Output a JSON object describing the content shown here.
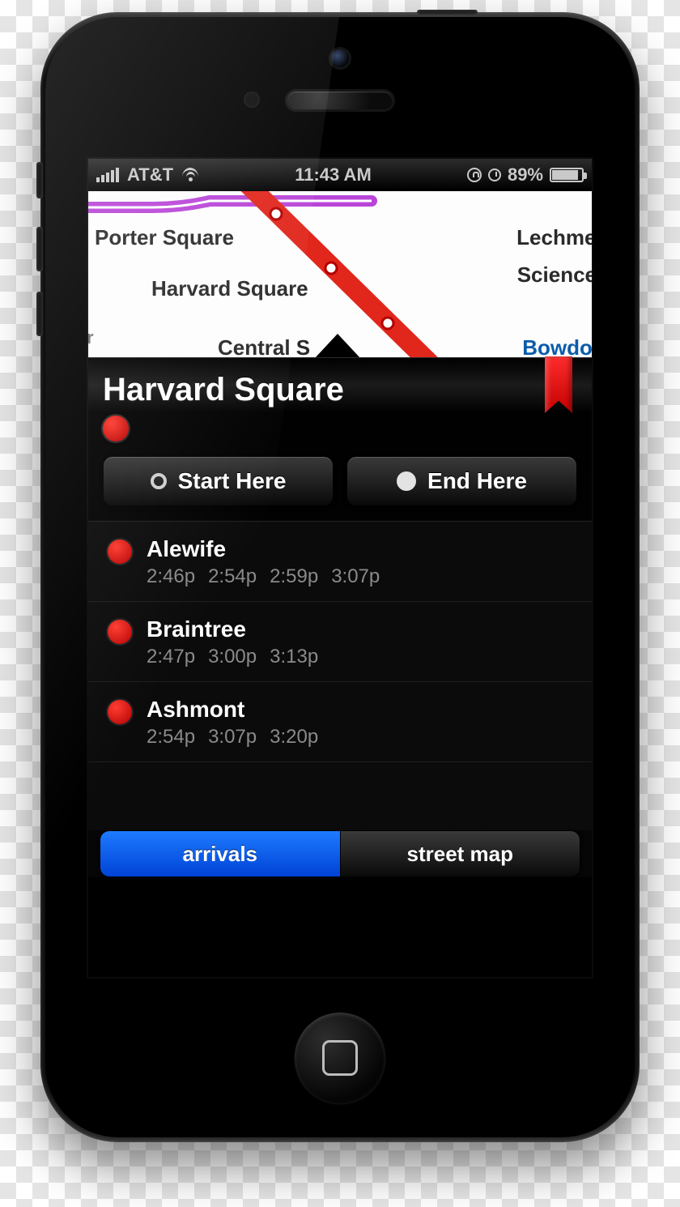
{
  "status_bar": {
    "carrier": "AT&T",
    "time": "11:43 AM",
    "battery_percent": "89%"
  },
  "map": {
    "stations": {
      "porter": "Porter Square",
      "harvard": "Harvard Square",
      "central": "Central S",
      "lechmere": "Lechmere",
      "science": "Science",
      "bowdoin": "Bowdoin"
    }
  },
  "station": {
    "name": "Harvard Square",
    "line_color": "#ff1a17"
  },
  "buttons": {
    "start": "Start Here",
    "end": "End Here"
  },
  "arrivals": [
    {
      "dest": "Alewife",
      "times": [
        "2:46p",
        "2:54p",
        "2:59p",
        "3:07p"
      ]
    },
    {
      "dest": "Braintree",
      "times": [
        "2:47p",
        "3:00p",
        "3:13p"
      ]
    },
    {
      "dest": "Ashmont",
      "times": [
        "2:54p",
        "3:07p",
        "3:20p"
      ]
    }
  ],
  "tabs": {
    "arrivals": "arrivals",
    "streetmap": "street map"
  }
}
